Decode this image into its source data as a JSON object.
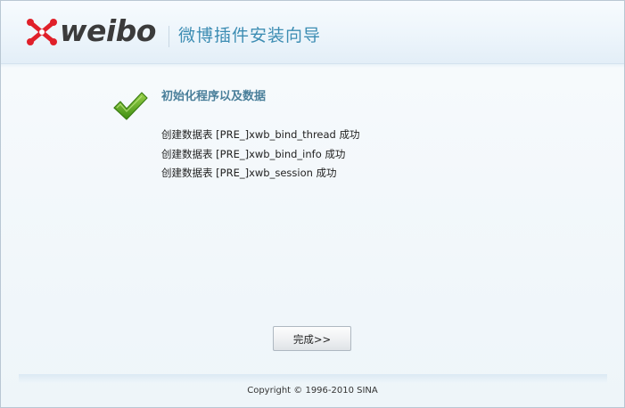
{
  "header": {
    "logo_text": "weibo",
    "title": "微博插件安装向导"
  },
  "main": {
    "status_icon": "check-icon",
    "section_title": "初始化程序以及数据",
    "log": [
      "创建数据表 [PRE_]xwb_bind_thread 成功",
      "创建数据表 [PRE_]xwb_bind_info 成功",
      "创建数据表 [PRE_]xwb_session 成功"
    ]
  },
  "actions": {
    "finish_label": "完成>>"
  },
  "footer": {
    "copyright": "Copyright © 1996-2010 SINA"
  },
  "colors": {
    "accent": "#3d8db3",
    "logo_mark": "#e0202a",
    "check": "#5aa51e"
  }
}
